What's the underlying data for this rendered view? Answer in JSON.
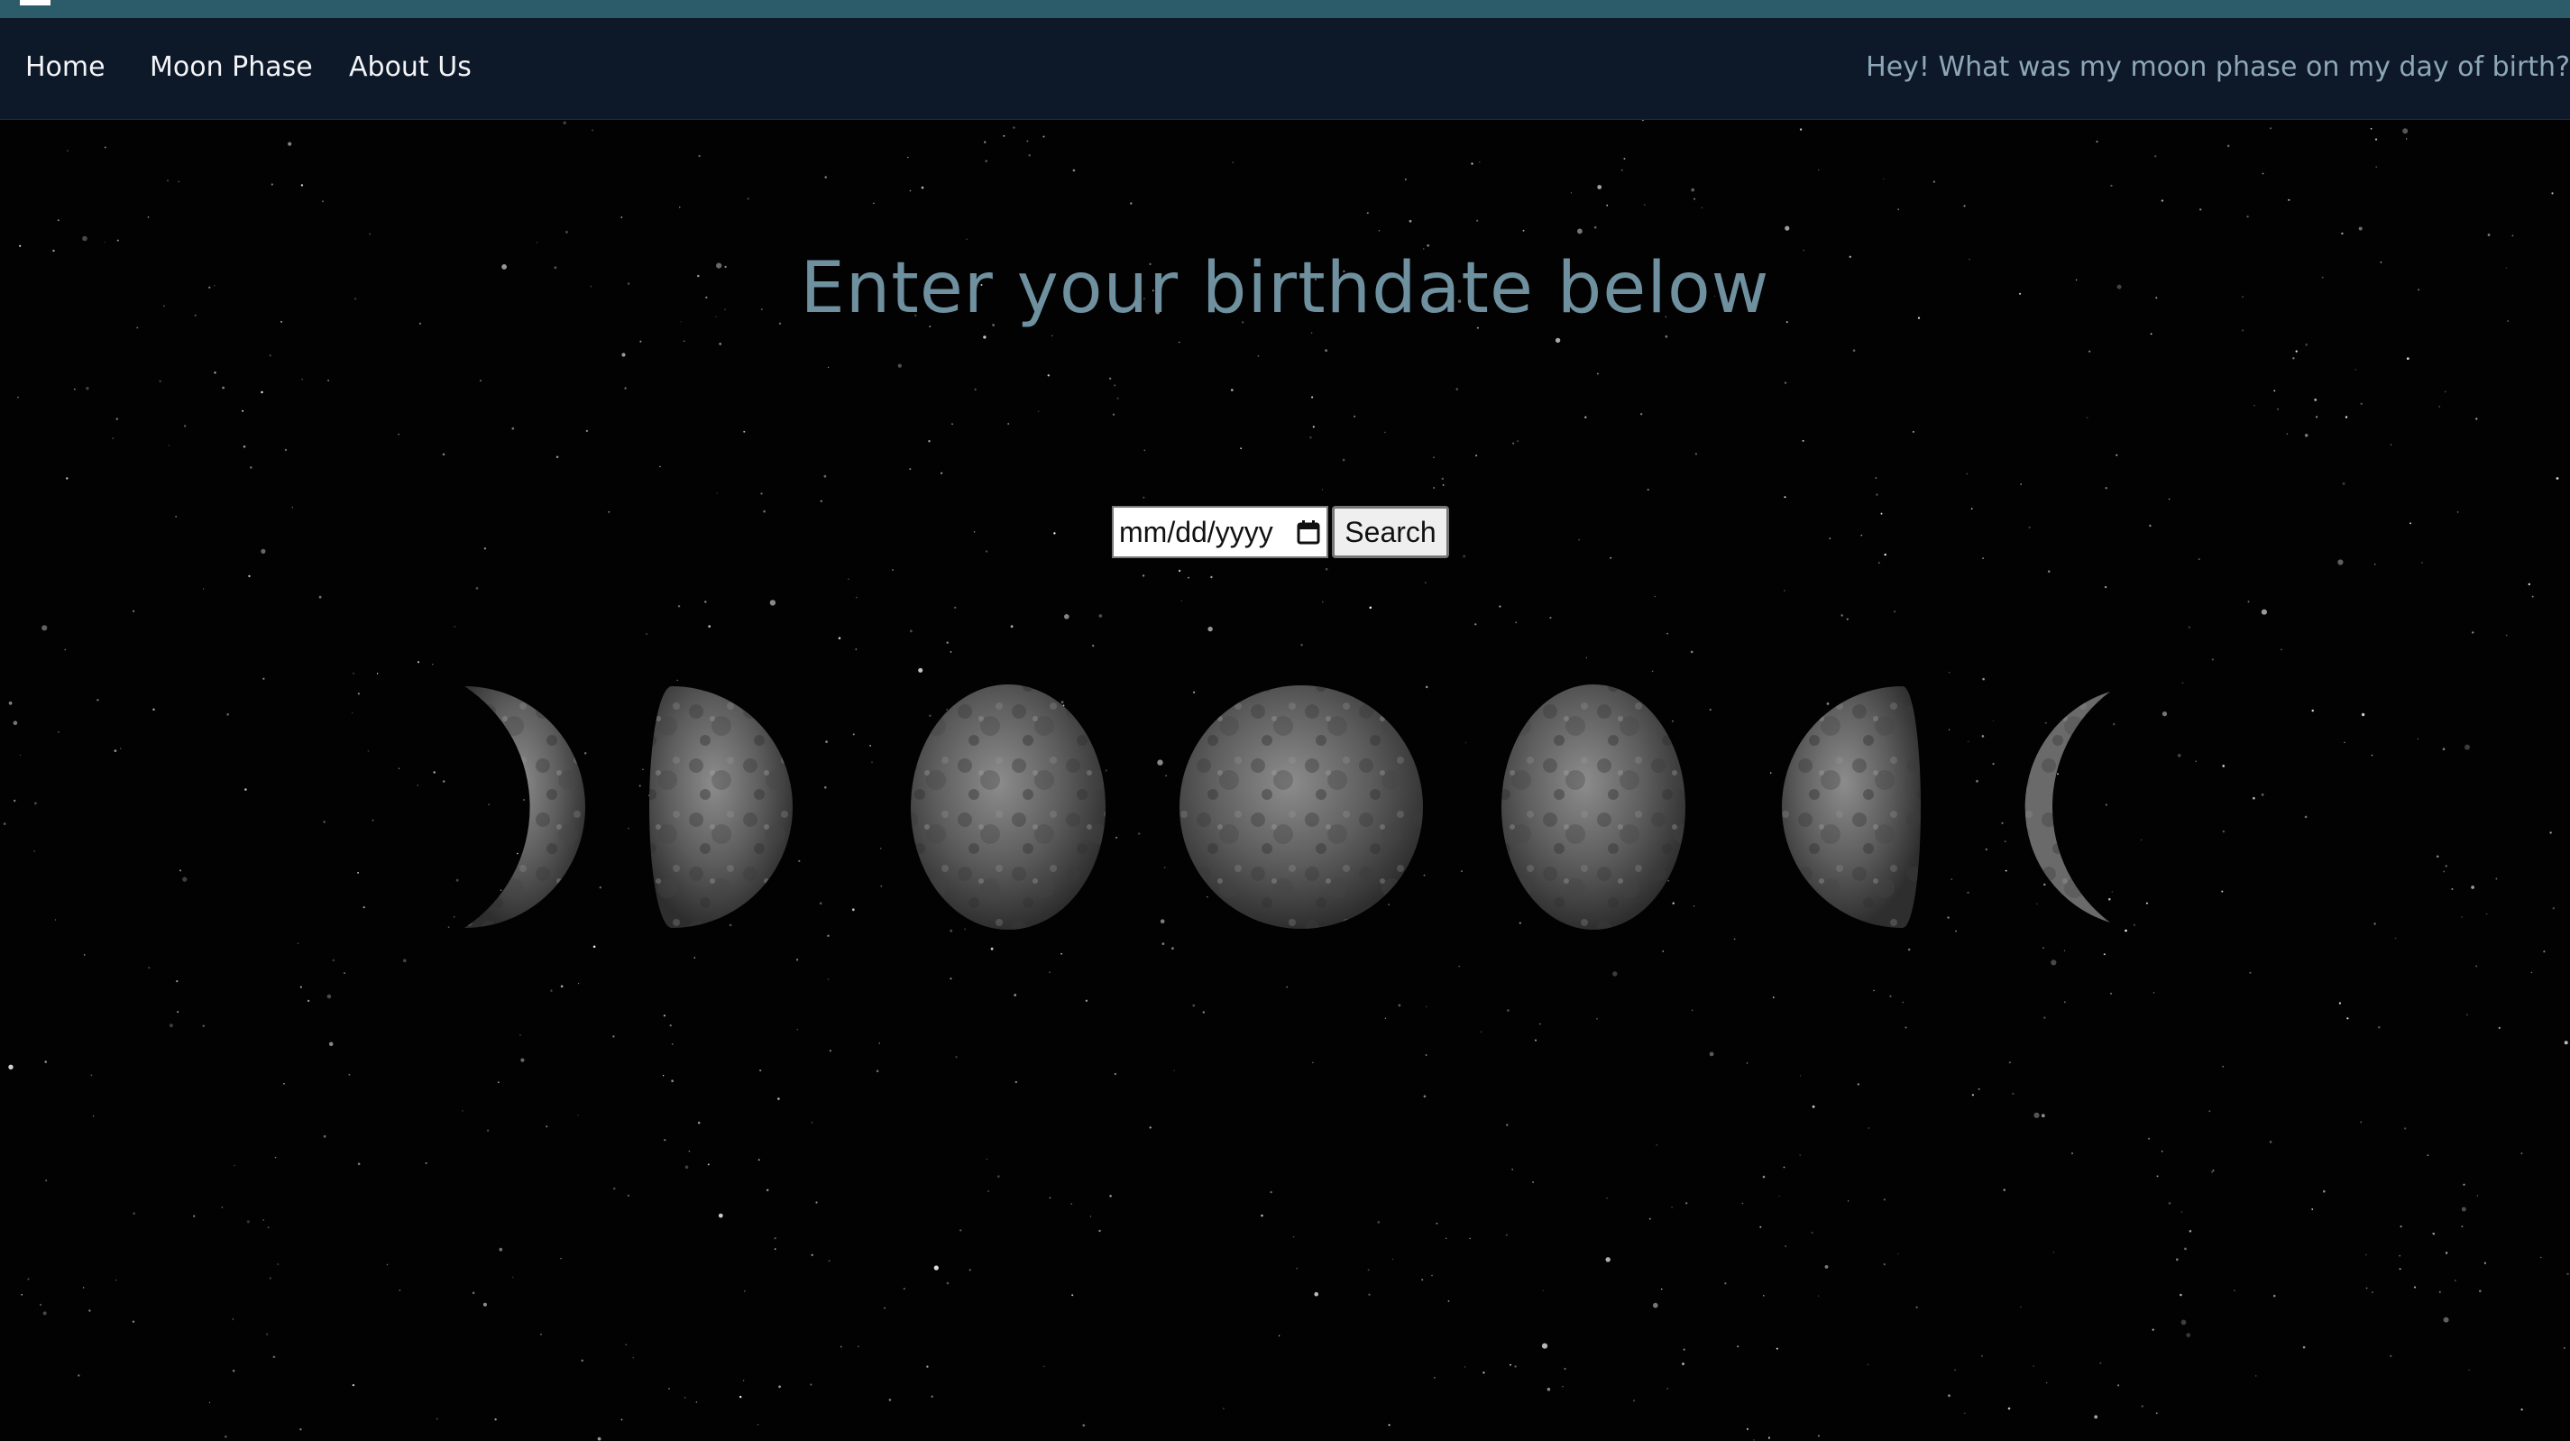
{
  "nav": {
    "home_label": "Home",
    "moon_phase_label": "Moon Phase",
    "about_label": "About Us",
    "tagline": "Hey! What was my moon phase on my day of birth?"
  },
  "main": {
    "headline": "Enter your birthdate below",
    "date_placeholder": "mm/dd/yyyy",
    "search_label": "Search"
  },
  "moon_phases": [
    {
      "name": "waning-crescent"
    },
    {
      "name": "last-quarter"
    },
    {
      "name": "waning-gibbous"
    },
    {
      "name": "full-moon"
    },
    {
      "name": "waxing-gibbous"
    },
    {
      "name": "first-quarter"
    },
    {
      "name": "waxing-crescent"
    }
  ],
  "colors": {
    "nav_background": "#0d1829",
    "top_strip": "#2c5c6a",
    "headline": "#6f909f",
    "tagline": "#8ea7b7",
    "background": "#020202"
  },
  "icons": {
    "calendar": "calendar-icon",
    "menu": "menu-icon"
  }
}
